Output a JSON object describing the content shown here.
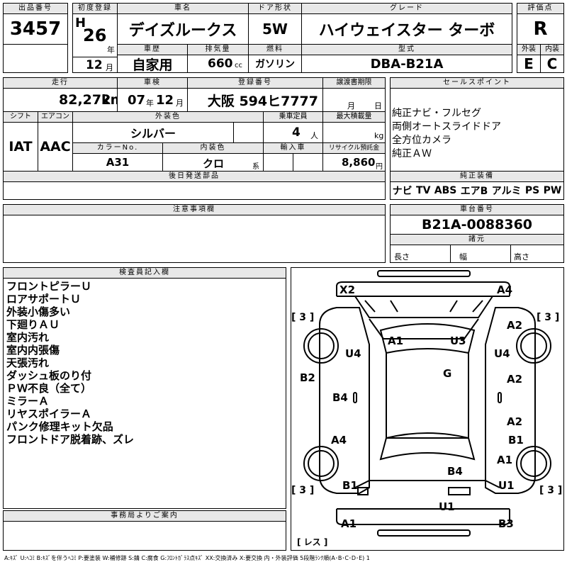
{
  "header": {
    "lot_label": "出品番号",
    "lot": "3457",
    "first_reg_label": "初度登録",
    "era": "H",
    "year": "26",
    "year_unit": "年",
    "month": "12",
    "month_unit": "月",
    "car_name_label": "車名",
    "car_name": "デイズルークス",
    "doors_label": "ドア形状",
    "doors": "5W",
    "grade_label": "グレード",
    "grade": "ハイウェイスター ターボ",
    "score_label": "評価点",
    "score": "R",
    "history_label": "車歴",
    "history": "自家用",
    "displacement_label": "排気量",
    "displacement": "660",
    "displacement_unit": "cc",
    "fuel_label": "燃料",
    "fuel": "ガソリン",
    "model_label": "型式",
    "model": "DBA-B21A",
    "ext_label": "外装",
    "ext": "E",
    "int_label": "内装",
    "int": "C"
  },
  "row2": {
    "mileage_label": "走行",
    "mileage": "82,272",
    "mileage_unit": "km",
    "inspection_label": "車検",
    "insp_year": "07",
    "insp_year_unit": "年",
    "insp_month": "12",
    "insp_month_unit": "月",
    "reg_no_label": "登録番号",
    "reg_no": "大阪 594ヒ7777",
    "transfer_label": "譲渡書期限",
    "transfer_month": "月",
    "transfer_day": "日",
    "sales_label": "セールスポイント",
    "sales_points": [
      "純正ナビ・フルセグ",
      "両側オートスライドドア",
      "全方位カメラ",
      "純正ＡＷ"
    ]
  },
  "row3": {
    "shift_label": "シフト",
    "shift": "IAT",
    "ac_label": "エアコン",
    "ac": "AAC",
    "color_label": "外装色",
    "color": "シルバー",
    "capacity_label": "乗車定員",
    "capacity": "4",
    "capacity_unit": "人",
    "load_label": "最大積載量",
    "load_unit": "kg",
    "color_no_label": "カラーNo.",
    "color_no": "A31",
    "int_color_label": "内装色",
    "int_color": "クロ",
    "int_color_unit": "系",
    "import_label": "輸入車",
    "recycle_label": "リサイクル預託金",
    "recycle": "8,860",
    "recycle_unit": "円"
  },
  "later_parts_label": "後日発送部品",
  "genuine": {
    "label": "純正装備",
    "items": [
      "ナビ",
      "TV",
      "ABS",
      "エアB",
      "アルミ",
      "PS",
      "PW"
    ]
  },
  "notes_label": "注意事項欄",
  "chassis": {
    "label": "車台番号",
    "value": "B21A-0088360",
    "dims_label": "諸元",
    "length": "長さ",
    "width": "幅",
    "height": "高さ"
  },
  "inspector": {
    "label": "検査員記入欄",
    "lines": [
      "フロントピラーＵ",
      "ロアサポートＵ",
      "外装小傷多い",
      "下廻りＡＵ",
      "室内汚れ",
      "室内内張傷",
      "天張汚れ",
      "ダッシュ板のり付",
      "ＰＷ不良（全て）",
      "ミラーＡ",
      "リヤスポイラーＡ",
      "パンク修理キット欠品",
      "フロントドア脱着跡、ズレ"
    ]
  },
  "office_label": "事務局よりご案内",
  "diagram": {
    "tire_marks": [
      "[ 3 ]",
      "[ 3 ]",
      "[ 3 ]",
      "[ 3 ]"
    ],
    "spare": "[ レス ]",
    "damage": [
      "X2",
      "A4",
      "A2",
      "A1",
      "U3",
      "U4",
      "U4",
      "G",
      "B2",
      "A2",
      "B4",
      "A2",
      "B1",
      "A4",
      "A1",
      "B4",
      "B1",
      "U1",
      "U1",
      "A1",
      "B3"
    ]
  },
  "legend": "A:ｷｽﾞ U:ﾍｺﾐ B:ｷｽﾞを伴うﾍｺﾐ P:要塗装 W:補修跡 S:錆 C:腐食 G:ﾌﾛﾝﾄｶﾞﾗｽ点ｷｽﾞ XX:交換済み X:要交換 内・外装評価 5段階ﾗﾝｸ順(A･B･C･D･E) 1"
}
